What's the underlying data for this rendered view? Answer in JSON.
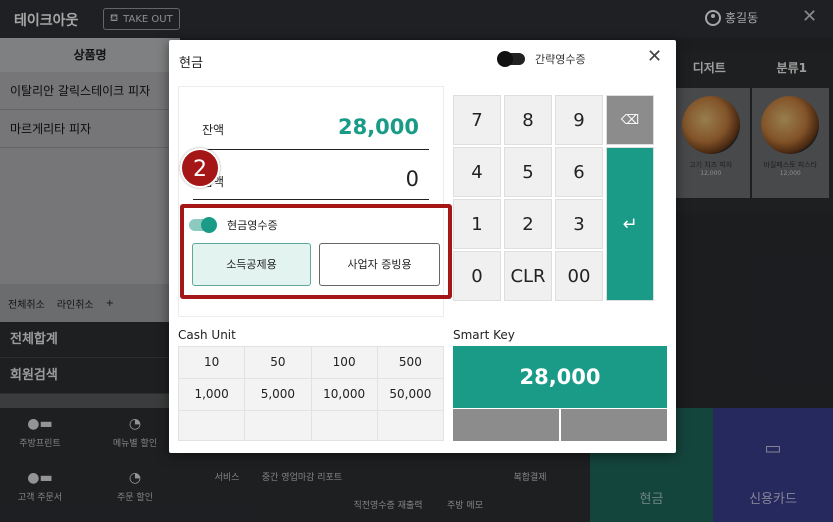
{
  "header": {
    "app_title": "테이크아웃",
    "takeout_label": "TAKE OUT",
    "user_name": "홍길동",
    "close_glyph": "✕"
  },
  "left_panel": {
    "column_header": "상품명",
    "items": [
      "이탈리안 갈릭스테이크 피자",
      "마르게리타 피자"
    ],
    "actions": [
      "전체취소",
      "라인취소",
      "+"
    ],
    "total_label": "전체합계",
    "member_search_label": "회원검색"
  },
  "right_panel": {
    "tabs": [
      "디저트",
      "분류1"
    ],
    "products": [
      {
        "name": "고기 치즈 피자",
        "price": "12,000"
      },
      {
        "name": "바질페스토 피스타",
        "price": "12,000"
      }
    ]
  },
  "bottom_bar": {
    "row1": [
      "주방프린트",
      "메뉴별 할인"
    ],
    "row2": [
      "고객 주문서",
      "주문 할인",
      "서비스",
      "중간 영업마감 리포트",
      "직전영수증 재출력",
      "주방 메모",
      "복합결제"
    ],
    "cash_label": "현금",
    "card_label": "신용카드"
  },
  "modal": {
    "title": "현금",
    "simple_receipt_label": "간략영수증",
    "close_glyph": "✕",
    "balance_label": "잔액",
    "balance_value": "28,000",
    "received_label": "금액",
    "received_value": "0",
    "step_badge": "2",
    "cash_receipt_label": "현금영수증",
    "income_deduction_label": "소득공제용",
    "business_proof_label": "사업자 증빙용",
    "keypad": [
      "7",
      "8",
      "9",
      "4",
      "5",
      "6",
      "1",
      "2",
      "3",
      "0",
      "CLR",
      "00"
    ],
    "backspace_glyph": "⌫",
    "enter_glyph": "↵",
    "cash_unit_label": "Cash Unit",
    "cash_units": [
      "10",
      "50",
      "100",
      "500",
      "1,000",
      "5,000",
      "10,000",
      "50,000"
    ],
    "smart_key_label": "Smart Key",
    "smart_key_value": "28,000"
  },
  "colors": {
    "accent_teal": "#1a9b87",
    "highlight_red": "#a51616",
    "card_blue": "#3b3f8f"
  }
}
